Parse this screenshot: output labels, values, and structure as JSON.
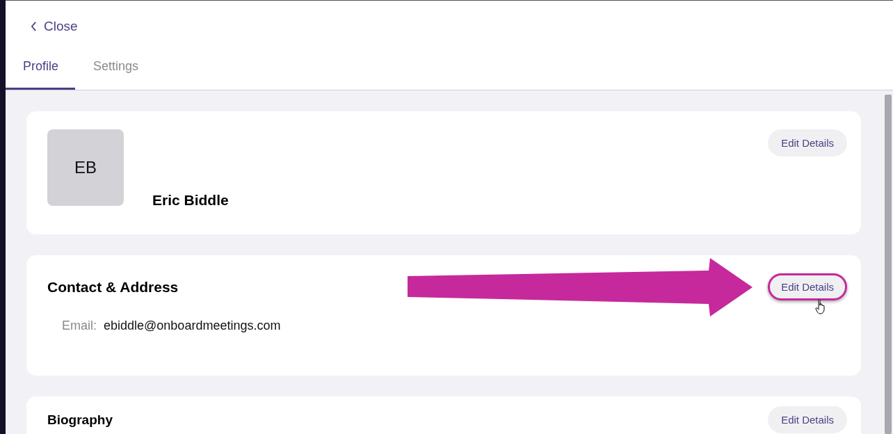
{
  "close": {
    "label": "Close"
  },
  "tabs": [
    {
      "label": "Profile",
      "selected": true
    },
    {
      "label": "Settings",
      "selected": false
    }
  ],
  "cards": [
    {
      "kind": "profile",
      "initials": "EB",
      "name": "Eric Biddle",
      "edit_button": {
        "label": "Edit Details",
        "highlighted": false
      }
    },
    {
      "kind": "contact",
      "title": "Contact & Address",
      "fields": [
        {
          "label": "Email:",
          "value": "ebiddle@onboardmeetings.com"
        }
      ],
      "edit_button": {
        "label": "Edit Details",
        "highlighted": true
      }
    },
    {
      "kind": "section",
      "title": "Biography",
      "edit_button": {
        "label": "Edit Details",
        "highlighted": false
      }
    }
  ]
}
